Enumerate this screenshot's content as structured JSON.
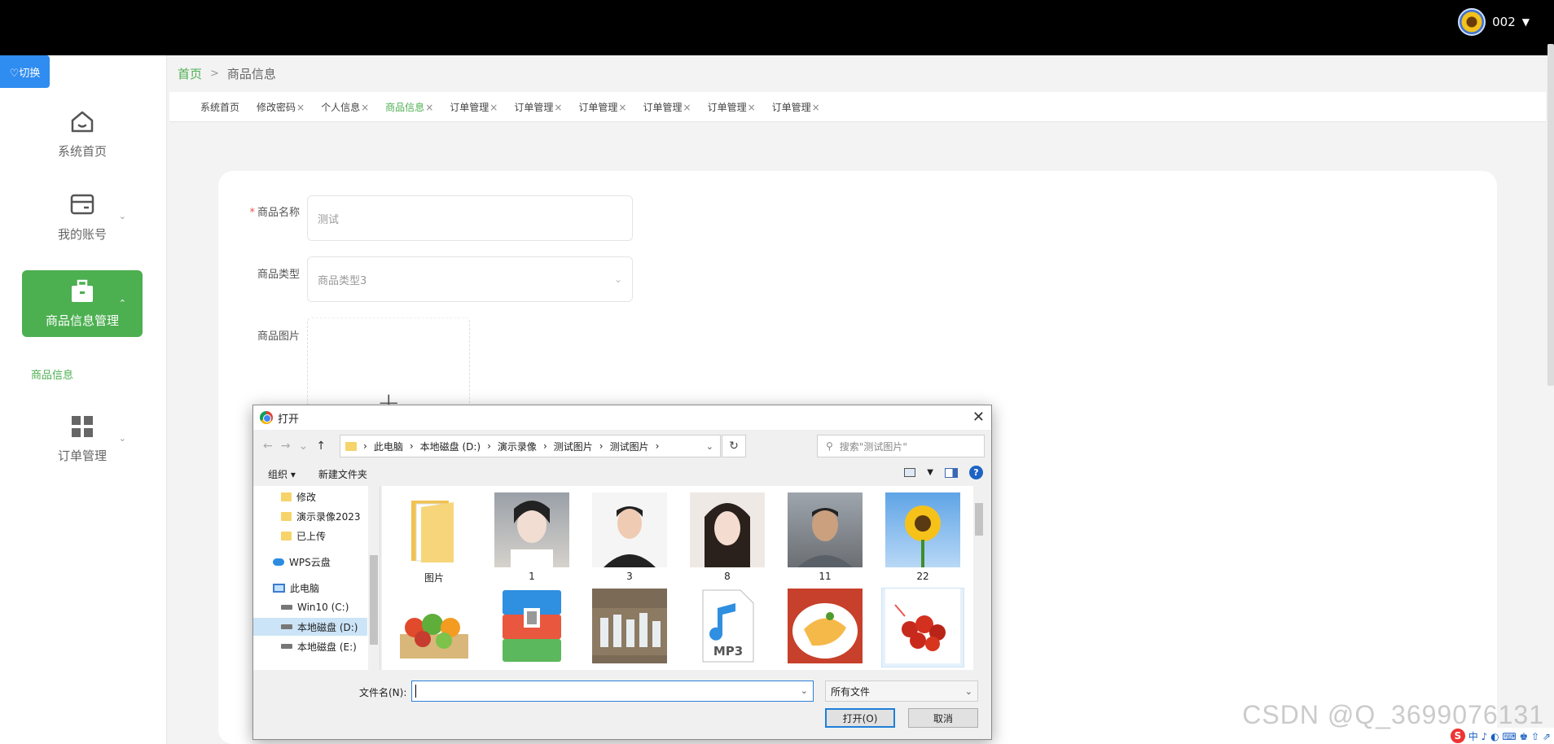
{
  "topbar": {
    "username": "002"
  },
  "sidebar": {
    "switch_label": "♡切换",
    "items": [
      {
        "label": "系统首页"
      },
      {
        "label": "我的账号"
      },
      {
        "label": "商品信息管理"
      },
      {
        "label": "订单管理"
      }
    ],
    "sub_item": "商品信息"
  },
  "breadcrumb": {
    "home": "首页",
    "sep": ">",
    "current": "商品信息"
  },
  "tabs": [
    {
      "label": "系统首页",
      "close": ""
    },
    {
      "label": "修改密码",
      "close": "×"
    },
    {
      "label": "个人信息",
      "close": "×"
    },
    {
      "label": "商品信息",
      "close": "×"
    },
    {
      "label": "订单管理",
      "close": "×"
    },
    {
      "label": "订单管理",
      "close": "×"
    },
    {
      "label": "订单管理",
      "close": "×"
    },
    {
      "label": "订单管理",
      "close": "×"
    },
    {
      "label": "订单管理",
      "close": "×"
    },
    {
      "label": "订单管理",
      "close": "×"
    }
  ],
  "form": {
    "name_label": "商品名称",
    "name_required": "*",
    "name_value": "测试",
    "type_label": "商品类型",
    "type_value": "商品类型3",
    "image_label": "商品图片",
    "upload_plus": "+"
  },
  "dialog": {
    "title": "打开",
    "close": "✕",
    "path": [
      "此电脑",
      "本地磁盘 (D:)",
      "演示录像",
      "测试图片",
      "测试图片"
    ],
    "search_placeholder": "搜索\"测试图片\"",
    "organize": "组织 ▾",
    "new_folder": "新建文件夹",
    "tree": [
      {
        "label": "修改",
        "icon": "folder"
      },
      {
        "label": "演示录像2023",
        "icon": "folder"
      },
      {
        "label": "已上传",
        "icon": "folder"
      },
      {
        "label": "WPS云盘",
        "icon": "cloud"
      },
      {
        "label": "此电脑",
        "icon": "pc"
      },
      {
        "label": "Win10 (C:)",
        "icon": "drive"
      },
      {
        "label": "本地磁盘 (D:)",
        "icon": "drive"
      },
      {
        "label": "本地磁盘 (E:)",
        "icon": "drive"
      }
    ],
    "files": [
      {
        "label": "图片",
        "kind": "folder"
      },
      {
        "label": "1",
        "kind": "portrait"
      },
      {
        "label": "3",
        "kind": "portrait"
      },
      {
        "label": "8",
        "kind": "portrait"
      },
      {
        "label": "11",
        "kind": "portrait"
      },
      {
        "label": "22",
        "kind": "sunflower"
      },
      {
        "label": "",
        "kind": "vegetables"
      },
      {
        "label": "",
        "kind": "archive"
      },
      {
        "label": "",
        "kind": "bottles"
      },
      {
        "label": "",
        "kind": "mp3"
      },
      {
        "label": "",
        "kind": "food"
      },
      {
        "label": "",
        "kind": "crayfish"
      }
    ],
    "mp3_text": "MP3",
    "filename_label": "文件名(N):",
    "filter_value": "所有文件",
    "open_button": "打开(O)",
    "cancel_button": "取消"
  },
  "watermark": "CSDN @Q_3699076131",
  "tray": {
    "s": "S",
    "text": "中 ♪ ◐ ⌨ ♚ ⇧ ⇗"
  },
  "colors": {
    "accent": "#4caf50",
    "switch": "#2f8cf0",
    "topbar": "#000000"
  }
}
